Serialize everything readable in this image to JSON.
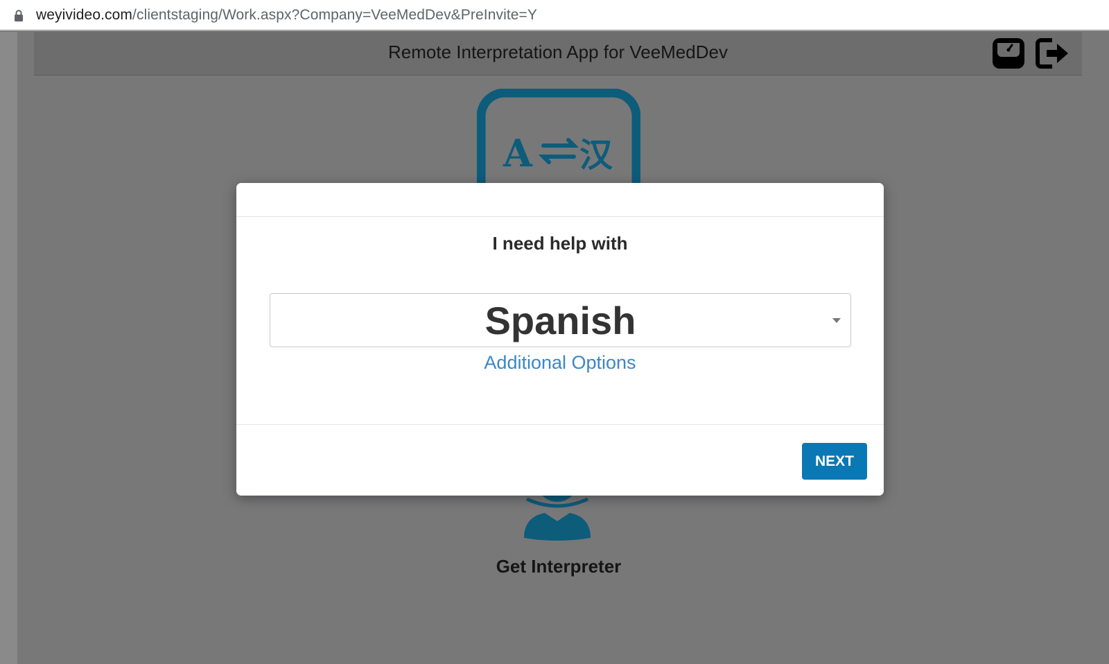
{
  "browser": {
    "url_host": "weyivideo.com",
    "url_path": "/clientstaging/Work.aspx?Company=VeeMedDev&PreInvite=Y"
  },
  "header": {
    "title": "Remote Interpretation App for VeeMedDev",
    "icons": [
      "scale-icon",
      "logout-icon"
    ]
  },
  "background": {
    "logo": "translate-icon",
    "get_interpreter_label": "Get Interpreter"
  },
  "modal": {
    "heading": "I need help with",
    "language_select": {
      "selected": "Spanish"
    },
    "additional_options_label": "Additional Options",
    "next_label": "NEXT"
  },
  "colors": {
    "accent": "#0a78b4",
    "link": "#3a87c6",
    "logo_teal": "#0d5c7a"
  }
}
